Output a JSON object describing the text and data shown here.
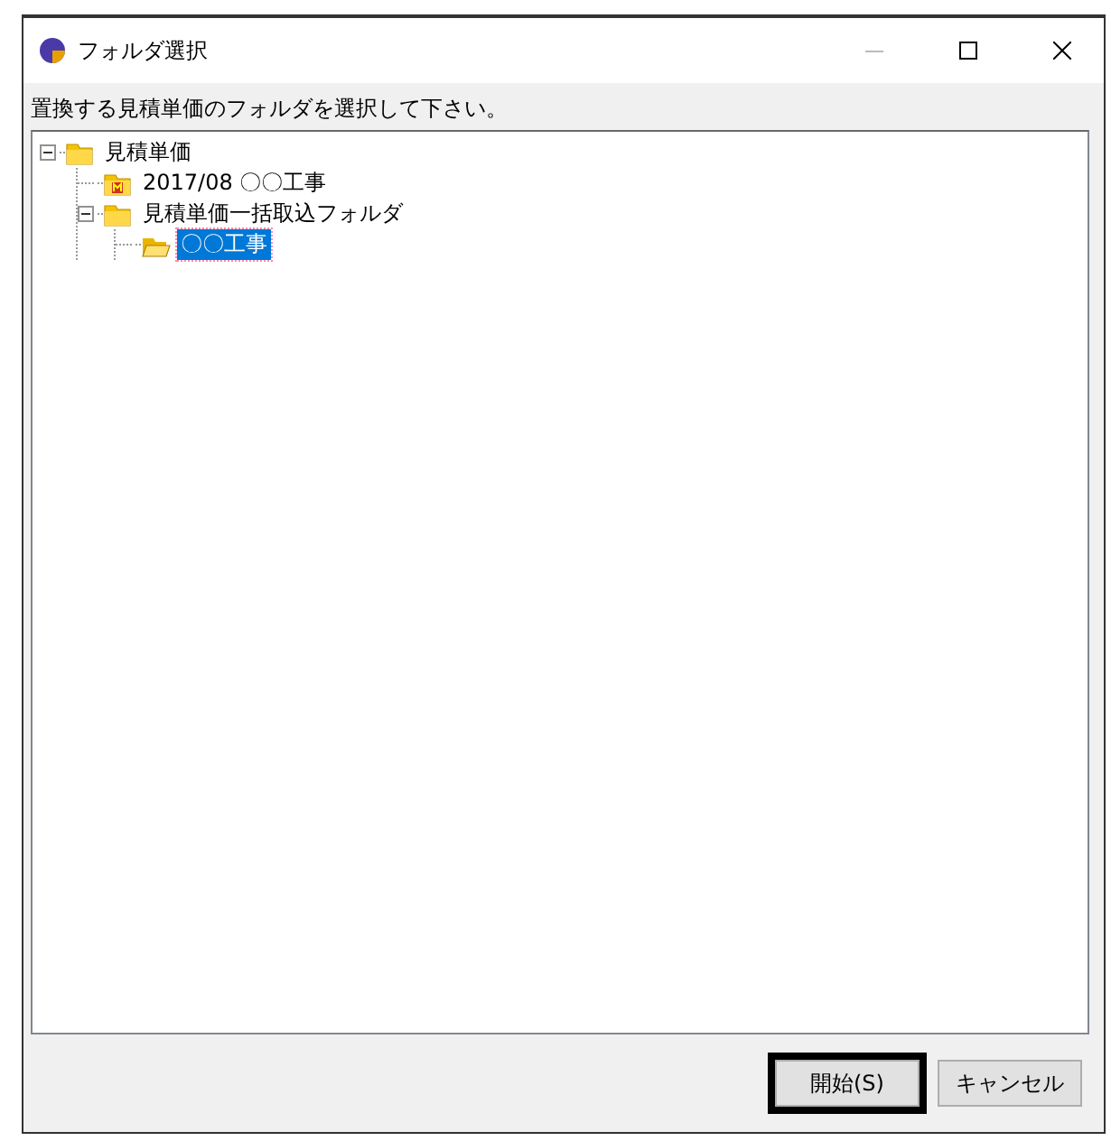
{
  "window": {
    "title": "フォルダ選択"
  },
  "prompt": "置換する見積単価のフォルダを選択して下さい。",
  "tree": [
    {
      "label": "見積単価",
      "kind": "closed",
      "expanded": true,
      "selected": false,
      "children": [
        {
          "label": "2017/08 〇〇工事",
          "kind": "marked",
          "selected": false
        },
        {
          "label": "見積単価一括取込フォルダ",
          "kind": "closed",
          "expanded": true,
          "selected": false,
          "children": [
            {
              "label": "〇〇工事",
              "kind": "open",
              "selected": true
            }
          ]
        }
      ]
    }
  ],
  "buttons": [
    {
      "label": "開始(S)",
      "default": true
    },
    {
      "label": "キャンセル",
      "default": false
    }
  ]
}
